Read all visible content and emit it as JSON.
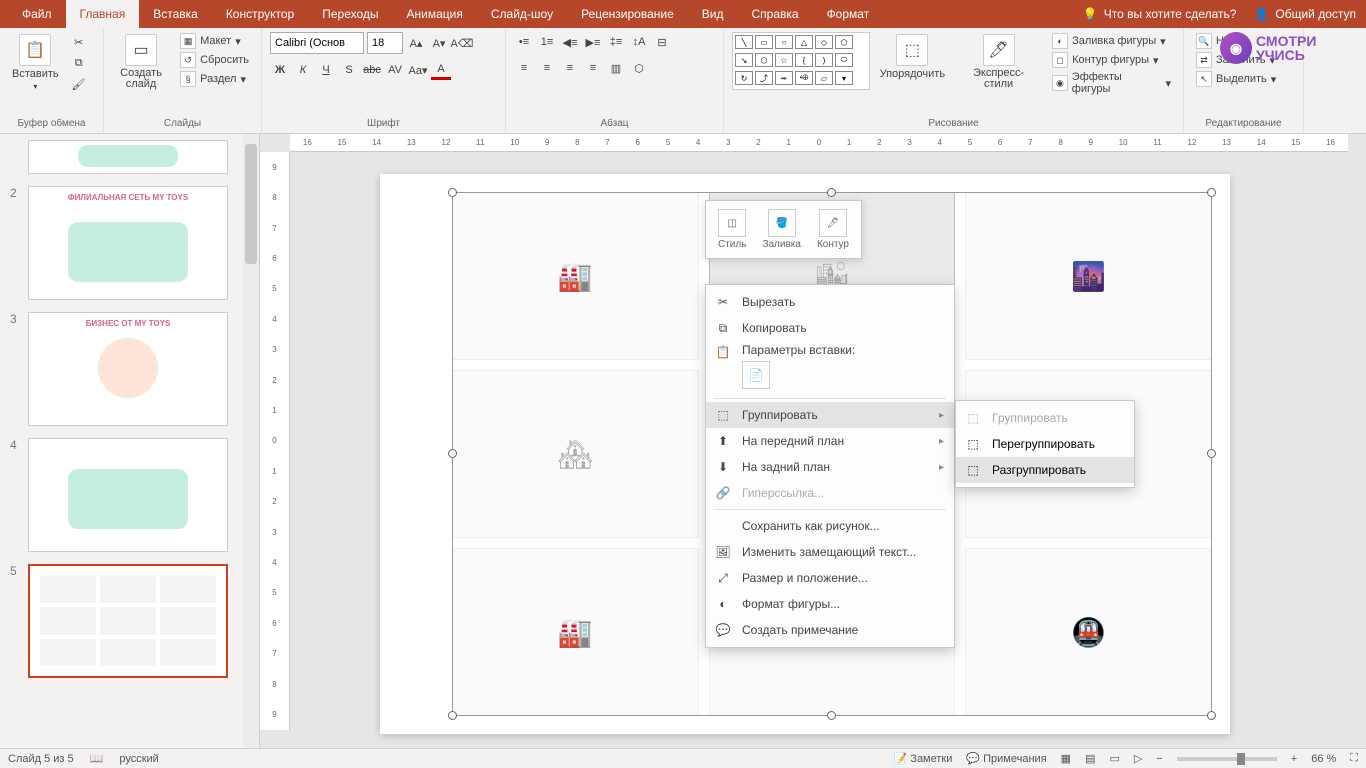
{
  "tabs": {
    "file": "Файл",
    "home": "Главная",
    "insert": "Вставка",
    "design": "Конструктор",
    "transitions": "Переходы",
    "animation": "Анимация",
    "slideshow": "Слайд-шоу",
    "review": "Рецензирование",
    "view": "Вид",
    "help": "Справка",
    "format": "Формат",
    "tellme": "Что вы хотите сделать?",
    "share": "Общий доступ"
  },
  "ribbon": {
    "clipboard": {
      "label": "Буфер обмена",
      "paste": "Вставить"
    },
    "slides": {
      "label": "Слайды",
      "new_slide": "Создать слайд",
      "layout": "Макет",
      "reset": "Сбросить",
      "section": "Раздел"
    },
    "font": {
      "label": "Шрифт",
      "family": "Calibri (Основ",
      "size": "18"
    },
    "paragraph": {
      "label": "Абзац"
    },
    "drawing": {
      "label": "Рисование",
      "arrange": "Упорядочить",
      "quick_styles": "Экспресс-стили",
      "shape_fill": "Заливка фигуры",
      "shape_outline": "Контур фигуры",
      "shape_effects": "Эффекты фигуры"
    },
    "editing": {
      "label": "Редактирование",
      "find": "Найти",
      "replace": "Заменить",
      "select": "Выделить"
    }
  },
  "logo": {
    "line1": "СМОТРИ",
    "line2": "УЧИСЬ"
  },
  "ruler_marks": [
    "16",
    "15",
    "14",
    "13",
    "12",
    "11",
    "10",
    "9",
    "8",
    "7",
    "6",
    "5",
    "4",
    "3",
    "2",
    "1",
    "0",
    "1",
    "2",
    "3",
    "4",
    "5",
    "6",
    "7",
    "8",
    "9",
    "10",
    "11",
    "12",
    "13",
    "14",
    "15",
    "16"
  ],
  "vruler_marks": [
    "9",
    "8",
    "7",
    "6",
    "5",
    "4",
    "3",
    "2",
    "1",
    "0",
    "1",
    "2",
    "3",
    "4",
    "5",
    "6",
    "7",
    "8",
    "9"
  ],
  "thumbnails": {
    "count": 5,
    "items": [
      {
        "num": "",
        "title": ""
      },
      {
        "num": "2",
        "title": "ФИЛИАЛЬНАЯ СЕТЬ MY TOYS"
      },
      {
        "num": "3",
        "title": "БИЗНЕС ОТ MY TOYS"
      },
      {
        "num": "4",
        "title": ""
      },
      {
        "num": "5",
        "title": ""
      }
    ],
    "selected": 5
  },
  "mini_toolbar": {
    "style": "Стиль",
    "fill": "Заливка",
    "outline": "Контур"
  },
  "context_menu": {
    "cut": "Вырезать",
    "copy": "Копировать",
    "paste_options": "Параметры вставки:",
    "group": "Группировать",
    "bring_front": "На передний план",
    "send_back": "На задний план",
    "hyperlink": "Гиперссылка...",
    "save_picture": "Сохранить как рисунок...",
    "alt_text": "Изменить замещающий текст...",
    "size_position": "Размер и положение...",
    "format_shape": "Формат фигуры...",
    "new_comment": "Создать примечание"
  },
  "submenu": {
    "group": "Группировать",
    "regroup": "Перегруппировать",
    "ungroup": "Разгруппировать"
  },
  "status": {
    "slide_info": "Слайд 5 из 5",
    "language": "русский",
    "notes": "Заметки",
    "comments": "Примечания",
    "zoom": "66 %"
  }
}
